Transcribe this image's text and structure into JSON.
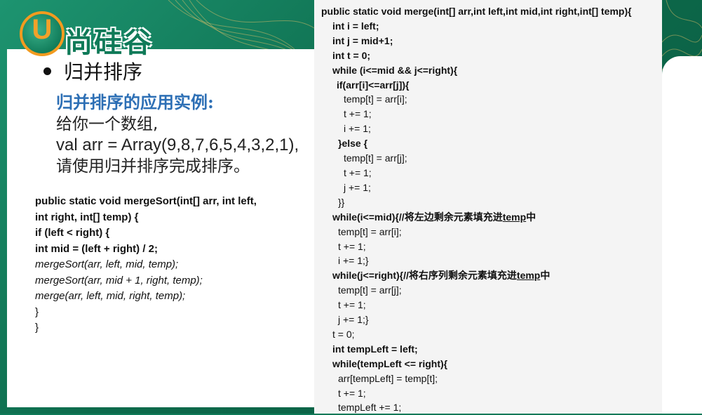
{
  "logo": {
    "badge_letter": "U",
    "brand_text": "尚硅谷"
  },
  "slide": {
    "bullet_title": "归并排序",
    "example_title": "归并排序的应用实例:",
    "example_lines": [
      "给你一个数组,",
      "val arr = Array(9,8,7,6,5,4,3,2,1),",
      "请使用归并排序完成排序。"
    ]
  },
  "merge_sort_code": [
    "public static void mergeSort(int[] arr, int left,",
    "int right, int[] temp) {",
    "if (left < right) {",
    "int mid = (left + right) / 2;",
    "mergeSort(arr, left, mid, temp);",
    "mergeSort(arr, mid + 1, right, temp);",
    "merge(arr, left, mid, right, temp);",
    "}",
    "}"
  ],
  "merge_code": {
    "l01": "public static void merge(int[] arr,int left,int mid,int right,int[] temp){",
    "l02": "int i = left;",
    "l03": "int j = mid+1;",
    "l04": "int t = 0;",
    "l05": "while (i<=mid && j<=right){",
    "l06": "if(arr[i]<=arr[j]){",
    "l07": "temp[t] = arr[i];",
    "l08": "t += 1;",
    "l09": "i += 1;",
    "l10": "}else {",
    "l11": "temp[t] = arr[j];",
    "l12": "t += 1;",
    "l13": "j += 1;",
    "l14": "}}",
    "l15a": "while(i<=mid){//将左边剩余元素填充进",
    "l15b": "temp",
    "l15c": "中",
    "l16": "temp[t] = arr[i];",
    "l17": "t += 1;",
    "l18": "i += 1;}",
    "l19a": "while(j<=right){//将右序列剩余元素填充进",
    "l19b": "temp",
    "l19c": "中",
    "l20": "temp[t] = arr[j];",
    "l21": "t += 1;",
    "l22": "j += 1;}",
    "l23": "t = 0;",
    "l24": "int tempLeft = left;",
    "l25": "while(tempLeft <= right){",
    "l26": "arr[tempLeft] = temp[t];",
    "l27": "t += 1;",
    "l28": "tempLeft += 1;"
  }
}
